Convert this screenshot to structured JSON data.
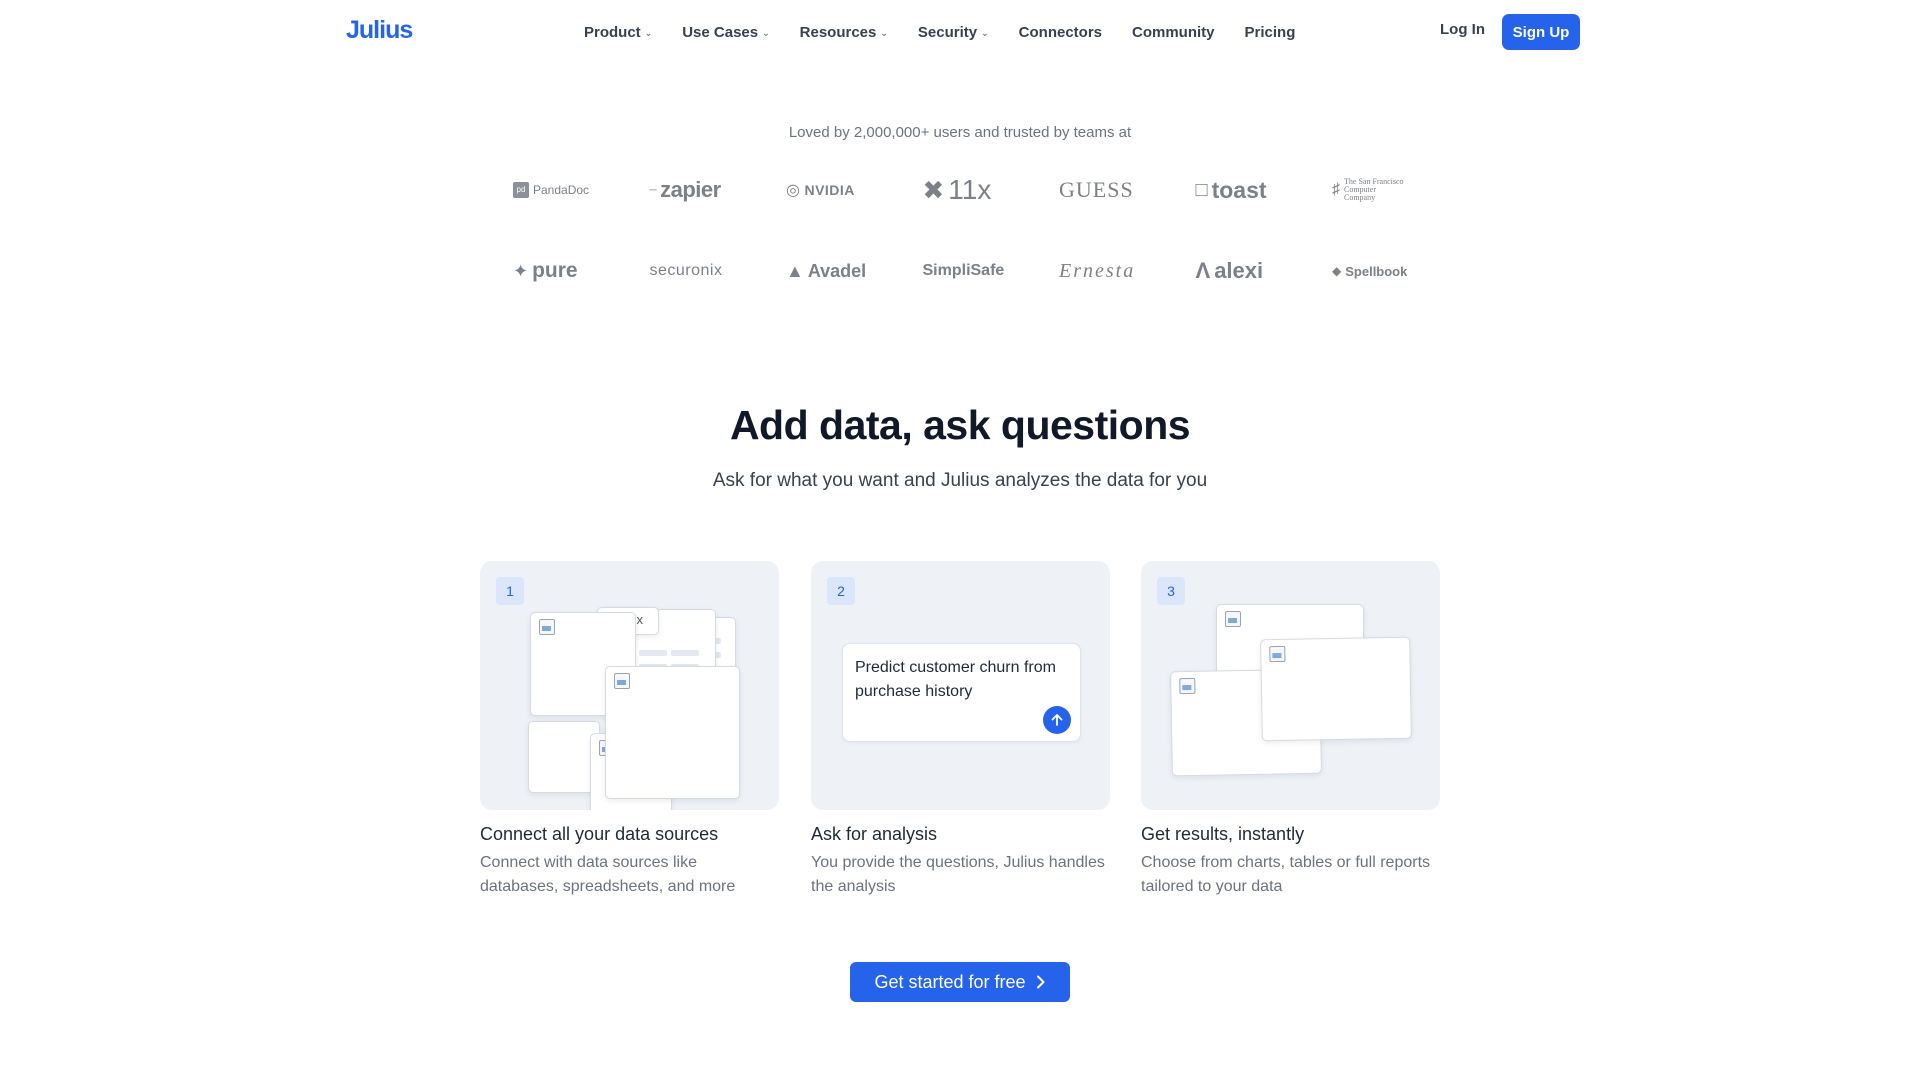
{
  "nav": {
    "logo": "Julius",
    "menu": [
      {
        "label": "Product",
        "dropdown": true
      },
      {
        "label": "Use Cases",
        "dropdown": true
      },
      {
        "label": "Resources",
        "dropdown": true
      },
      {
        "label": "Security",
        "dropdown": true
      },
      {
        "label": "Connectors",
        "dropdown": false
      },
      {
        "label": "Community",
        "dropdown": false
      },
      {
        "label": "Pricing",
        "dropdown": false
      }
    ],
    "login": "Log In",
    "signup": "Sign Up"
  },
  "trust": {
    "tagline": "Loved by 2,000,000+ users and trusted by teams at",
    "logos": [
      "PandaDoc",
      "zapier",
      "NVIDIA",
      "11x",
      "GUESS",
      "toast",
      "The San Francisco Computer Company",
      "pure",
      "securonix",
      "Avadel",
      "SimpliSafe",
      "Ernesta",
      "alexi",
      "Spellbook"
    ]
  },
  "hero": {
    "title": "Add data, ask questions",
    "subtitle": "Ask for what you want and Julius analyzes the data for you"
  },
  "steps": [
    {
      "number": "1",
      "title": "Connect all your data sources",
      "description": "Connect with data sources like databases, spreadsheets, and more",
      "file_label": "sx"
    },
    {
      "number": "2",
      "title": "Ask for analysis",
      "description": "You provide the questions, Julius handles the analysis",
      "prompt": "Predict customer churn from purchase history"
    },
    {
      "number": "3",
      "title": "Get results, instantly",
      "description": "Choose from charts, tables or full reports tailored to your data"
    }
  ],
  "cta": {
    "label": "Get started for free"
  },
  "colors": {
    "accent": "#2563eb",
    "card_bg": "#eef2f7"
  }
}
